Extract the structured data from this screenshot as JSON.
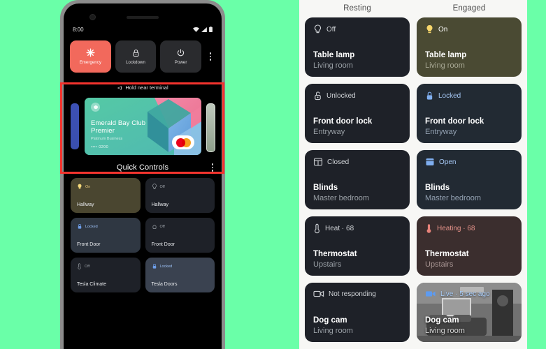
{
  "background_color": "#6AFFA8",
  "phone": {
    "status_bar": {
      "time": "8:00",
      "icons": [
        "wifi-icon",
        "cellular-signal-icon",
        "battery-icon"
      ]
    },
    "power_menu": {
      "buttons": [
        {
          "label": "Emergency",
          "icon": "emergency-asterisk-icon",
          "color": "#F2695C"
        },
        {
          "label": "Lockdown",
          "icon": "lock-icon",
          "color": "#2A2B2E"
        },
        {
          "label": "Power",
          "icon": "power-icon",
          "color": "#2A2B2E"
        }
      ],
      "overflow_icon": "kebab-menu-icon"
    },
    "wallet": {
      "hint": "Hold near terminal",
      "hint_icon": "nfc-icon",
      "card": {
        "title": "Emerald Bay Club Premier",
        "subtitle": "Platinum Business",
        "number": "•••• 0200",
        "network": "mastercard-logo",
        "logo_icon": "club-crest-icon"
      },
      "peek_left_label": "previous-card",
      "peek_right_label": "next-card"
    },
    "quick_controls": {
      "title": "Quick Controls",
      "overflow_icon": "kebab-menu-icon",
      "tiles": [
        {
          "status": "On",
          "name": "Hallway",
          "icon": "lightbulb-icon",
          "state": "lamp-on"
        },
        {
          "status": "Off",
          "name": "Hallway",
          "icon": "lightbulb-icon",
          "state": "off"
        },
        {
          "status": "Locked",
          "name": "Front Door",
          "icon": "lock-icon",
          "state": "lock-on"
        },
        {
          "status": "Off",
          "name": "Front Door",
          "icon": "lock-icon",
          "state": "off"
        },
        {
          "status": "Off",
          "name": "Tesla Climate",
          "icon": "thermostat-icon",
          "state": "off"
        },
        {
          "status": "Locked",
          "name": "Tesla Doors",
          "icon": "lock-icon",
          "state": "tesla-on"
        }
      ]
    }
  },
  "annotation": {
    "name": "wallet-highlight-box",
    "color": "#F4342E"
  },
  "state_grid": {
    "columns": [
      "Resting",
      "Engaged"
    ],
    "rows": [
      {
        "resting": {
          "status": "Off",
          "name": "Table lamp",
          "room": "Living room",
          "icon": "lightbulb-outline-icon"
        },
        "engaged": {
          "status": "On",
          "name": "Table lamp",
          "room": "Living room",
          "icon": "lightbulb-filled-icon"
        }
      },
      {
        "resting": {
          "status": "Unlocked",
          "name": "Front door lock",
          "room": "Entryway",
          "icon": "lock-open-icon"
        },
        "engaged": {
          "status": "Locked",
          "name": "Front door lock",
          "room": "Entryway",
          "icon": "lock-closed-icon"
        }
      },
      {
        "resting": {
          "status": "Closed",
          "name": "Blinds",
          "room": "Master bedroom",
          "icon": "blinds-closed-icon"
        },
        "engaged": {
          "status": "Open",
          "name": "Blinds",
          "room": "Master bedroom",
          "icon": "blinds-open-icon"
        }
      },
      {
        "resting": {
          "status": "Heat · 68",
          "name": "Thermostat",
          "room": "Upstairs",
          "icon": "thermometer-outline-icon"
        },
        "engaged": {
          "status": "Heating · 68",
          "name": "Thermostat",
          "room": "Upstairs",
          "icon": "thermometer-filled-icon"
        }
      },
      {
        "resting": {
          "status": "Not responding",
          "name": "Dog cam",
          "room": "Living room",
          "icon": "camera-outline-icon"
        },
        "engaged": {
          "status": "Live · 5 sec ago",
          "name": "Dog cam",
          "room": "Living room",
          "icon": "camera-filled-icon"
        }
      }
    ]
  }
}
